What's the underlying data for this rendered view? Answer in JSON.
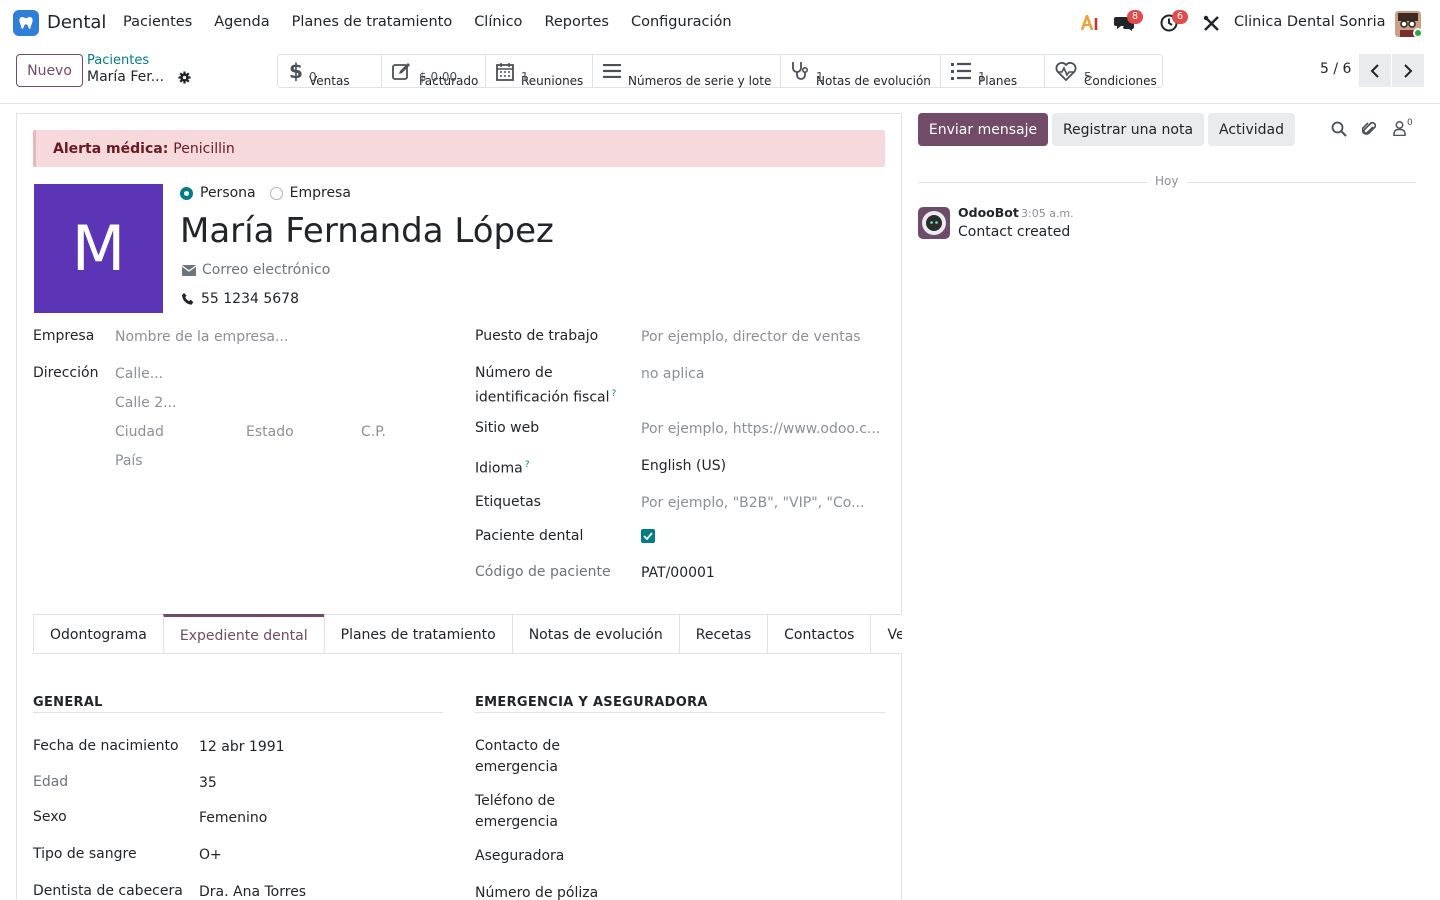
{
  "nav": {
    "app_name": "Dental",
    "menu": [
      "Pacientes",
      "Agenda",
      "Planes de tratamiento",
      "Clínico",
      "Reportes",
      "Configuración"
    ],
    "messages_badge": "8",
    "activities_badge": "6",
    "company": "Clinica Dental Sonria"
  },
  "control": {
    "new_label": "Nuevo",
    "breadcrumb_parent": "Pacientes",
    "breadcrumb_current": "María Fer...",
    "smart_buttons": [
      {
        "label": "Ventas",
        "value": "0",
        "icon": "dollar-icon"
      },
      {
        "label": "Facturado",
        "value": "$ 0.00",
        "icon": "invoice-icon"
      },
      {
        "label": "Reuniones",
        "value": "1",
        "icon": "calendar-icon"
      },
      {
        "label": "Números de serie y lote",
        "value": "",
        "icon": "list-icon"
      },
      {
        "label": "Notas de evolución",
        "value": "1",
        "icon": "stethoscope-icon"
      },
      {
        "label": "Planes",
        "value": "1",
        "icon": "list-ol-icon"
      },
      {
        "label": "Condiciones",
        "value": "5",
        "icon": "heartbeat-icon"
      }
    ],
    "pager": "5 / 6"
  },
  "form": {
    "alert_label": "Alerta médica:",
    "alert_value": "Penicillin",
    "avatar_letter": "M",
    "radio_person": "Persona",
    "radio_company": "Empresa",
    "name": "María Fernanda López",
    "email_placeholder": "Correo electrónico",
    "phone": "55 1234 5678",
    "left": {
      "company_label": "Empresa",
      "company_placeholder": "Nombre de la empresa...",
      "address_label": "Dirección",
      "street_placeholder": "Calle...",
      "street2_placeholder": "Calle 2...",
      "city_placeholder": "Ciudad",
      "state_placeholder": "Estado",
      "zip_placeholder": "C.P.",
      "country_placeholder": "País"
    },
    "right": {
      "job_label": "Puesto de trabajo",
      "job_placeholder": "Por ejemplo, director de ventas",
      "vat_label_1": "Número de",
      "vat_label_2": "identificación fiscal",
      "vat_placeholder": "no aplica",
      "website_label": "Sitio web",
      "website_placeholder": "Por ejemplo, https://www.odoo.c...",
      "lang_label": "Idioma",
      "lang_value": "English (US)",
      "tags_label": "Etiquetas",
      "tags_placeholder": "Por ejemplo, \"B2B\", \"VIP\", \"Co...",
      "dental_patient_label": "Paciente dental",
      "dental_patient_checked": true,
      "patient_code_label": "Código de paciente",
      "patient_code_value": "PAT/00001"
    },
    "help_mark": "?",
    "tabs": [
      "Odontograma",
      "Expediente dental",
      "Planes de tratamiento",
      "Notas de evolución",
      "Recetas",
      "Contactos",
      "Ve"
    ],
    "active_tab": 1,
    "general": {
      "title": "GENERAL",
      "birth_label": "Fecha de nacimiento",
      "birth_value": "12 abr 1991",
      "age_label": "Edad",
      "age_value": "35",
      "sex_label": "Sexo",
      "sex_value": "Femenino",
      "blood_label": "Tipo de sangre",
      "blood_value": "O+",
      "dentist_label": "Dentista de cabecera",
      "dentist_value": "Dra. Ana Torres"
    },
    "emergency": {
      "title": "EMERGENCIA Y ASEGURADORA",
      "contact_label_1": "Contacto de",
      "contact_label_2": "emergencia",
      "phone_label_1": "Teléfono de",
      "phone_label_2": "emergencia",
      "insurer_label": "Aseguradora",
      "policy_label": "Número de póliza"
    }
  },
  "chatter": {
    "send_label": "Enviar mensaje",
    "note_label": "Registrar una nota",
    "activity_label": "Actividad",
    "followers_count": "0",
    "today_label": "Hoy",
    "message": {
      "author": "OdooBot",
      "time": "3:05 a.m.",
      "body": "Contact created"
    }
  },
  "colors": {
    "primary": "#714b67",
    "accent": "#017e84",
    "avatar": "#5b35b6",
    "alert_bg": "#f5d9dc"
  }
}
